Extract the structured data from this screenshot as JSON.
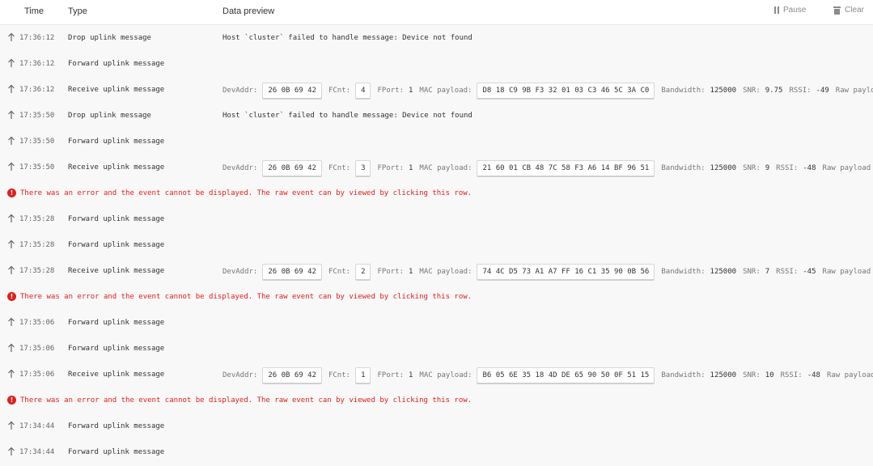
{
  "header": {
    "time_label": "Time",
    "type_label": "Type",
    "preview_label": "Data preview",
    "pause_label": "Pause",
    "clear_label": "Clear"
  },
  "error_text": "There was an error and the event cannot be displayed. The raw event can by viewed by clicking this row.",
  "labels": {
    "devaddr": "DevAddr:",
    "fcnt": "FCnt:",
    "fport": "FPort:",
    "mac_payload": "MAC payload:",
    "bandwidth": "Bandwidth:",
    "snr": "SNR:",
    "rssi": "RSSI:",
    "raw_payload": "Raw payload"
  },
  "events": [
    {
      "kind": "message",
      "time": "17:36:12",
      "type": "Drop uplink message",
      "message": "Host `cluster` failed to handle message: Device not found"
    },
    {
      "kind": "simple",
      "time": "17:36:12",
      "type": "Forward uplink message"
    },
    {
      "kind": "uplink",
      "time": "17:36:12",
      "type": "Receive uplink message",
      "devaddr": "26 0B 69 42",
      "fcnt": "4",
      "fport": "1",
      "mac_payload": "D8 18 C9 9B F3 32 01 03 C3 46 5C 3A C0",
      "bandwidth": "125000",
      "snr": "9.75",
      "rssi": "-49"
    },
    {
      "kind": "message",
      "time": "17:35:50",
      "type": "Drop uplink message",
      "message": "Host `cluster` failed to handle message: Device not found"
    },
    {
      "kind": "simple",
      "time": "17:35:50",
      "type": "Forward uplink message"
    },
    {
      "kind": "uplink",
      "time": "17:35:50",
      "type": "Receive uplink message",
      "devaddr": "26 0B 69 42",
      "fcnt": "3",
      "fport": "1",
      "mac_payload": "21 60 01 CB 48 7C 58 F3 A6 14 BF 96 51",
      "bandwidth": "125000",
      "snr": "9",
      "rssi": "-48"
    },
    {
      "kind": "error"
    },
    {
      "kind": "simple",
      "time": "17:35:28",
      "type": "Forward uplink message"
    },
    {
      "kind": "simple",
      "time": "17:35:28",
      "type": "Forward uplink message"
    },
    {
      "kind": "uplink",
      "time": "17:35:28",
      "type": "Receive uplink message",
      "devaddr": "26 0B 69 42",
      "fcnt": "2",
      "fport": "1",
      "mac_payload": "74 4C D5 73 A1 A7 FF 16 C1 35 90 0B 56",
      "bandwidth": "125000",
      "snr": "7",
      "rssi": "-45"
    },
    {
      "kind": "error"
    },
    {
      "kind": "simple",
      "time": "17:35:06",
      "type": "Forward uplink message"
    },
    {
      "kind": "simple",
      "time": "17:35:06",
      "type": "Forward uplink message"
    },
    {
      "kind": "uplink",
      "time": "17:35:06",
      "type": "Receive uplink message",
      "devaddr": "26 0B 69 42",
      "fcnt": "1",
      "fport": "1",
      "mac_payload": "B6 05 6E 35 18 4D DE 65 90 50 0F 51 15",
      "bandwidth": "125000",
      "snr": "10",
      "rssi": "-48"
    },
    {
      "kind": "error"
    },
    {
      "kind": "simple",
      "time": "17:34:44",
      "type": "Forward uplink message"
    },
    {
      "kind": "simple",
      "time": "17:34:44",
      "type": "Forward uplink message"
    }
  ]
}
